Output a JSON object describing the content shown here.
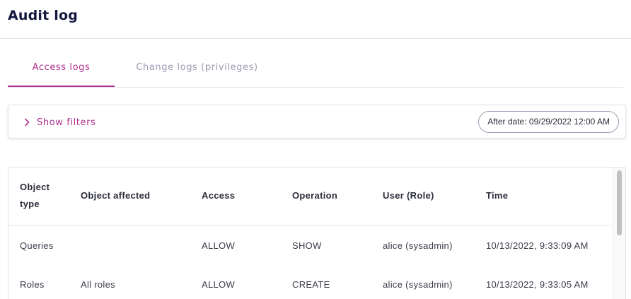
{
  "header": {
    "title": "Audit log"
  },
  "tabs": [
    {
      "label": "Access logs",
      "active": true
    },
    {
      "label": "Change logs (privileges)",
      "active": false
    }
  ],
  "filters": {
    "toggle_label": "Show filters",
    "toggle_icon": "chevron-right-icon",
    "date_chip": "After date: 09/29/2022 12:00 AM"
  },
  "table": {
    "columns": [
      "Object type",
      "Object affected",
      "Access",
      "Operation",
      "User (Role)",
      "Time"
    ],
    "rows": [
      [
        "Queries",
        "",
        "ALLOW",
        "SHOW",
        "alice (sysadmin)",
        "10/13/2022, 9:33:09 AM"
      ],
      [
        "Roles",
        "All roles",
        "ALLOW",
        "CREATE",
        "alice (sysadmin)",
        "10/13/2022, 9:33:05 AM"
      ]
    ]
  },
  "colors": {
    "accent": "#b0318f",
    "title": "#15173f",
    "inactive_tab": "#9a9cb2"
  }
}
